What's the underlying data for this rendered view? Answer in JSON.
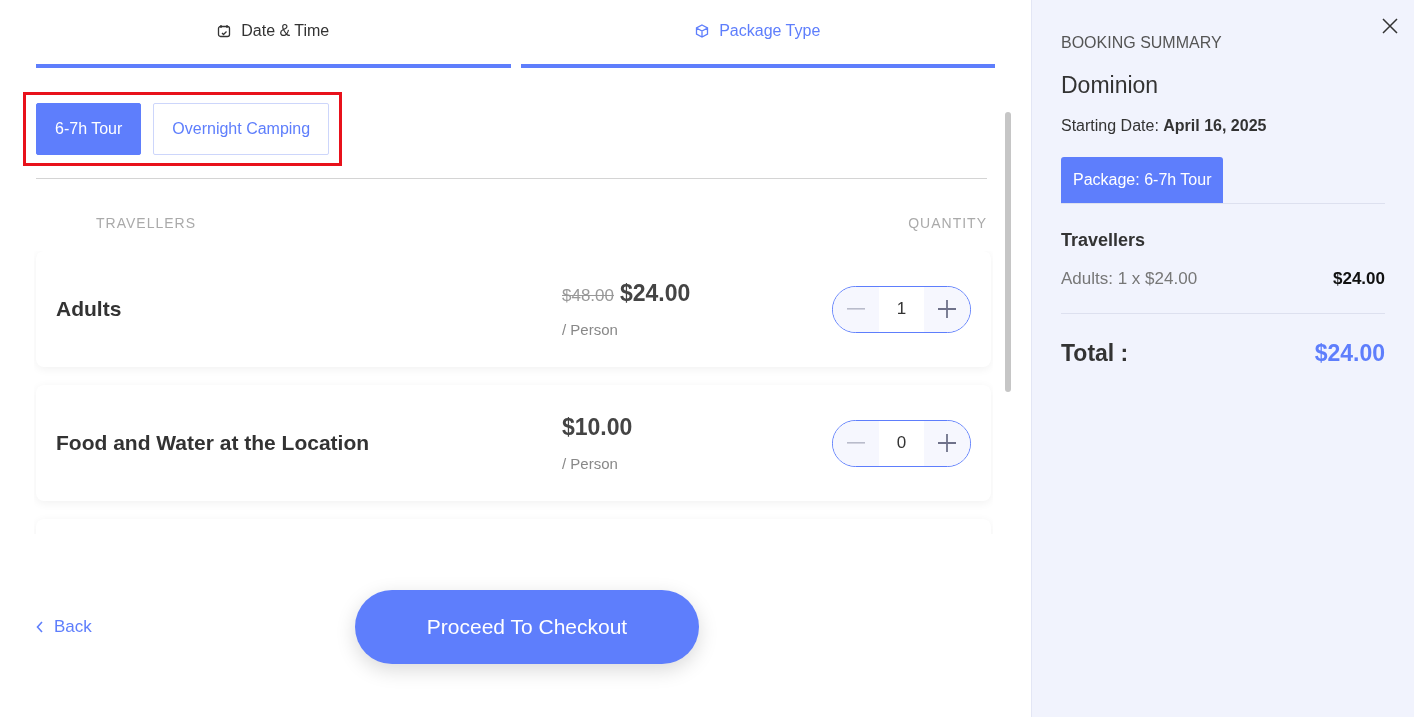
{
  "steps": [
    {
      "label": "Date & Time",
      "selected": false
    },
    {
      "label": "Package Type",
      "selected": true
    }
  ],
  "packages": [
    {
      "label": "6-7h Tour",
      "selected": true
    },
    {
      "label": "Overnight Camping",
      "selected": false
    }
  ],
  "columns": [
    "TRAVELLERS",
    "QUANTITY"
  ],
  "items": [
    {
      "name": "Adults",
      "old_price": "$48.00",
      "price": "$24.00",
      "unit": "/ Person",
      "quantity": "1"
    },
    {
      "name": "Food and Water at the Location",
      "price": "$10.00",
      "unit": "/ Person",
      "quantity": "0"
    }
  ],
  "back": "Back",
  "checkout": "Proceed To Checkout",
  "summary": {
    "heading": "BOOKING SUMMARY",
    "tour": "Dominion",
    "date_label": "Starting Date:",
    "date": "April 16, 2025",
    "package_tab": "Package: 6-7h Tour",
    "section": "Travellers",
    "lines": [
      {
        "label": "Adults: 1 x $24.00",
        "amount": "$24.00"
      }
    ],
    "total_label": "Total :",
    "total": "$24.00"
  }
}
